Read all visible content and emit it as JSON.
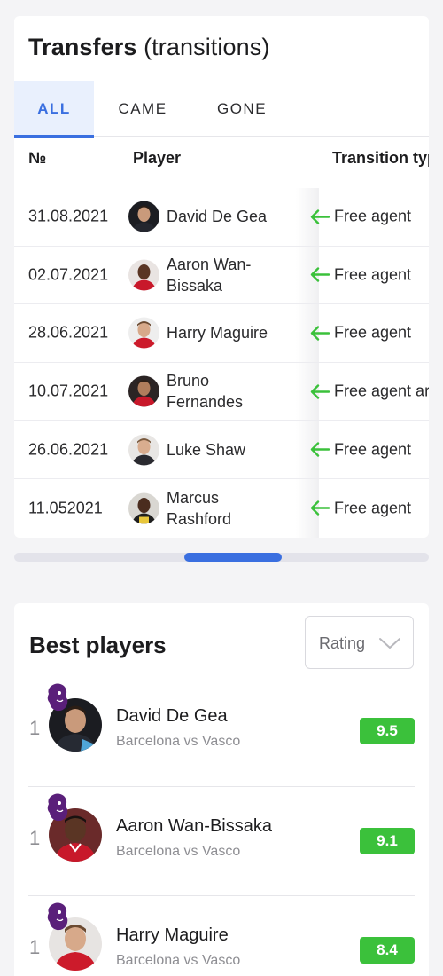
{
  "transfers": {
    "title": "Transfers",
    "title_suffix": "(transitions)",
    "tabs": [
      {
        "label": "ALL",
        "active": true
      },
      {
        "label": "CAME",
        "active": false
      },
      {
        "label": "GONE",
        "active": false
      }
    ],
    "columns": {
      "number": "№",
      "player": "Player",
      "type": "Transition typ"
    },
    "rows": [
      {
        "date": "31.08.2021",
        "player": "David De Gea",
        "type": "Free agent",
        "avatar": "david-de-gea-avatar"
      },
      {
        "date": "02.07.2021",
        "player": "Aaron Wan-Bissaka",
        "type": "Free agent",
        "avatar": "aaron-wan-bissaka-avatar"
      },
      {
        "date": "28.06.2021",
        "player": "Harry Maguire",
        "type": "Free agent",
        "avatar": "harry-maguire-avatar"
      },
      {
        "date": "10.07.2021",
        "player": "Bruno Fernandes",
        "type": "Free agent ar",
        "avatar": "bruno-fernandes-avatar"
      },
      {
        "date": "26.06.2021",
        "player": "Luke Shaw",
        "type": "Free agent",
        "avatar": "luke-shaw-avatar"
      },
      {
        "date": "11.052021",
        "player": "Marcus Rashford",
        "type": "Free agent",
        "avatar": "marcus-rashford-avatar"
      }
    ],
    "transition_icon": "arrow-left-icon",
    "transition_icon_color": "#3bc13b"
  },
  "best_players": {
    "title": "Best players",
    "sort_select": {
      "value": "Rating",
      "icon": "chevron-down-icon"
    },
    "players": [
      {
        "rank": "1",
        "name": "David De Gea",
        "match": "Barcelona vs Vasco",
        "rating": "9.5"
      },
      {
        "rank": "1",
        "name": "Aaron Wan-Bissaka",
        "match": "Barcelona vs Vasco",
        "rating": "9.1"
      },
      {
        "rank": "1",
        "name": "Harry Maguire",
        "match": "Barcelona vs Vasco",
        "rating": "8.4"
      }
    ],
    "league_icon": "premier-league-lion-icon",
    "rating_color": "#3bc13b"
  },
  "colors": {
    "accent": "#3a6fe0",
    "tab_active_bg": "#e9f0fd",
    "background": "#f4f4f6"
  }
}
